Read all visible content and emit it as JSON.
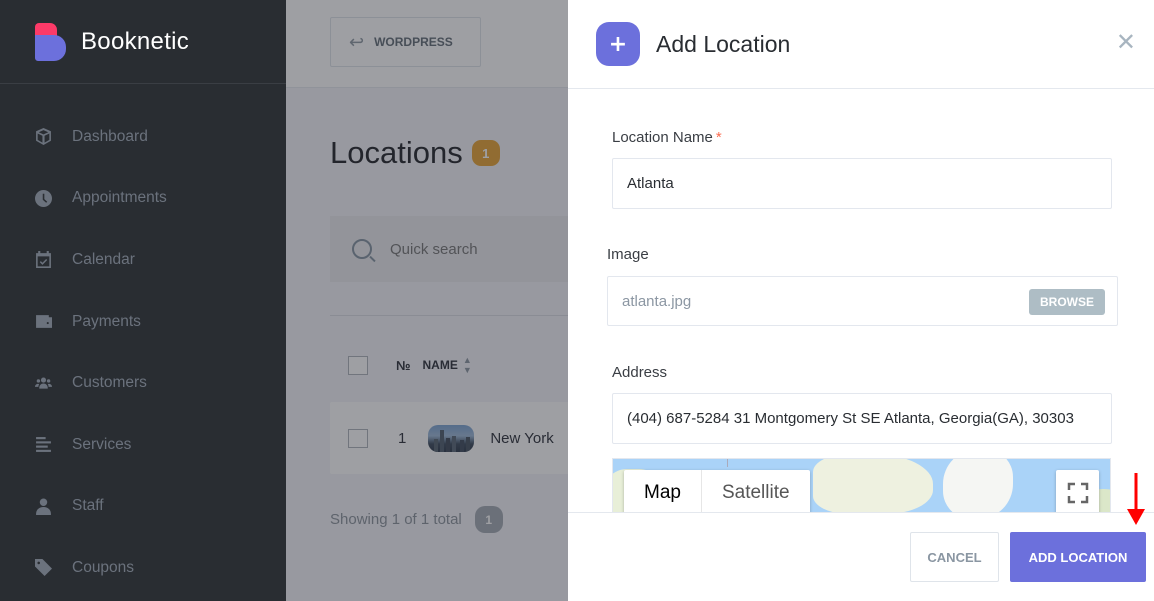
{
  "sidebar": {
    "brand": "Booknetic",
    "items": [
      {
        "label": "Dashboard",
        "icon": "cube-icon"
      },
      {
        "label": "Appointments",
        "icon": "clock-icon"
      },
      {
        "label": "Calendar",
        "icon": "calendar-check-icon"
      },
      {
        "label": "Payments",
        "icon": "wallet-icon"
      },
      {
        "label": "Customers",
        "icon": "users-icon"
      },
      {
        "label": "Services",
        "icon": "list-icon"
      },
      {
        "label": "Staff",
        "icon": "user-icon"
      },
      {
        "label": "Coupons",
        "icon": "tag-icon"
      }
    ]
  },
  "topbar": {
    "wordpress_label": "WORDPRESS"
  },
  "page": {
    "title": "Locations",
    "count": "1",
    "search_placeholder": "Quick search",
    "table": {
      "columns": [
        "№",
        "NAME"
      ],
      "rows": [
        {
          "num": "1",
          "name": "New York"
        }
      ]
    },
    "showing_text": "Showing 1 of 1 total",
    "showing_count": "1"
  },
  "modal": {
    "title": "Add Location",
    "close_symbol": "✕",
    "fields": {
      "location_name": {
        "label": "Location Name",
        "required_mark": "*",
        "value": "Atlanta"
      },
      "image": {
        "label": "Image",
        "filename": "atlanta.jpg",
        "browse_label": "BROWSE"
      },
      "address": {
        "label": "Address",
        "value": "(404) 687-5284 31 Montgomery St SE Atlanta, Georgia(GA), 30303"
      }
    },
    "map": {
      "map_label": "Map",
      "satellite_label": "Satellite",
      "active_type": "Map"
    },
    "buttons": {
      "cancel": "CANCEL",
      "add": "ADD LOCATION"
    }
  },
  "colors": {
    "accent": "#6c70dc",
    "brand_red": "#fc3a68",
    "badge_orange": "#e8a332",
    "sidebar_bg": "#292d32",
    "annotation_arrow": "#ff0000"
  }
}
